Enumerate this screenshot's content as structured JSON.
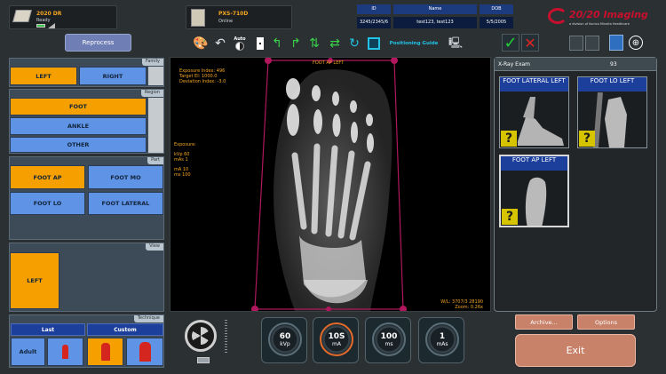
{
  "top": {
    "detector": {
      "name": "2020 DR",
      "status": "Ready"
    },
    "generator": {
      "name": "PXS-710D",
      "status": "Online"
    },
    "patient": {
      "headers": [
        "ID",
        "Name",
        "DOB"
      ],
      "values": [
        "3245/2345/6",
        "test123, test123",
        "5/5/2005"
      ]
    },
    "logo": {
      "brand": "20/20 Imaging",
      "tagline": "a division of Konica Minolta Healthcare"
    }
  },
  "toolbar": {
    "reprocess": "Reprocess",
    "auto": "Auto",
    "positioning_guide": "Positioning Guide"
  },
  "left": {
    "family": {
      "title": "Family",
      "options": [
        "LEFT",
        "RIGHT"
      ],
      "selected": "LEFT"
    },
    "region": {
      "title": "Region",
      "options": [
        "FOOT",
        "ANKLE",
        "OTHER"
      ],
      "selected": "FOOT"
    },
    "part": {
      "title": "Part",
      "options": [
        "FOOT AP",
        "FOOT MO",
        "FOOT LO",
        "FOOT LATERAL"
      ],
      "selected": "FOOT AP"
    },
    "view": {
      "title": "View",
      "options": [
        "LEFT"
      ],
      "selected": "LEFT"
    },
    "technique": {
      "title": "Technique",
      "tabs": [
        "Last",
        "Custom"
      ],
      "size": "Adult"
    }
  },
  "image": {
    "label": "FOOT AP LEFT",
    "exposure_index": "Exposure Index: 496",
    "target_ei": "Target EI: 1000.0",
    "deviation_index": "Deviation Index: -3.0",
    "exposure": "Exposure:",
    "kvp": "kVp 60",
    "mas": "mAs 1",
    "ma": "mA 10",
    "ms": "ms 100",
    "wl": "W/L: 3707/3 28190",
    "zoom": "Zoom: 0.26x"
  },
  "exam": {
    "title": "X-Ray Exam",
    "count": "93",
    "thumbs": [
      {
        "label": "FOOT LATERAL LEFT"
      },
      {
        "label": "FOOT LO LEFT"
      },
      {
        "label": "FOOT AP LEFT"
      }
    ],
    "archive": "Archive...",
    "options": "Options",
    "exit": "Exit"
  },
  "dials": [
    {
      "value": "60",
      "unit": "kVp"
    },
    {
      "value": "10S",
      "unit": "mA"
    },
    {
      "value": "100",
      "unit": "ms"
    },
    {
      "value": "1",
      "unit": "mAs"
    }
  ],
  "colors": {
    "selected": "#f5a000",
    "option": "#5f93e6",
    "thumb_title": "#1d3f9c",
    "frame": "#b0175c"
  }
}
